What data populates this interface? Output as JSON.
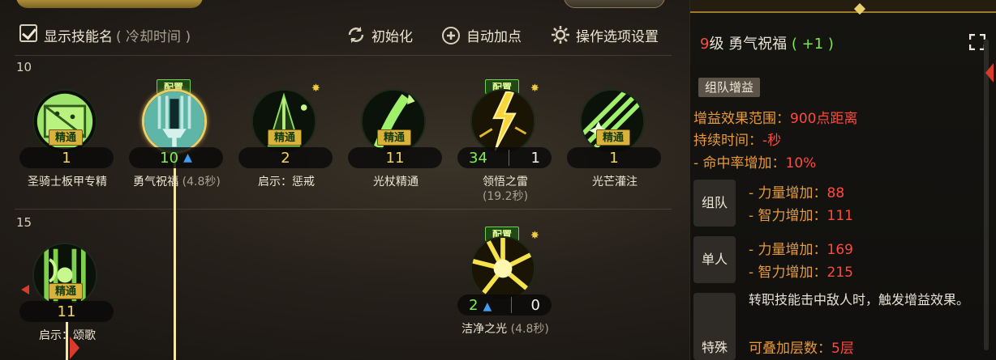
{
  "toolbar": {
    "show_names_label": "显示技能名",
    "show_names_sub": "( 冷却时间 )",
    "reset_label": "初始化",
    "auto_label": "自动加点",
    "settings_label": "操作选项设置"
  },
  "tree": {
    "level_10": "10",
    "level_15": "15",
    "skills": [
      {
        "name": "圣骑士板甲专精",
        "cd": "",
        "level": "1",
        "tag": "精通",
        "config": "",
        "bonus": "",
        "star": false,
        "selected": false
      },
      {
        "name": "勇气祝福",
        "cd": "(4.8秒)",
        "level": "10",
        "tag": "",
        "config": "配置",
        "bonus": "",
        "star": false,
        "selected": true,
        "boosted": true
      },
      {
        "name": "启示：惩戒",
        "cd": "",
        "level": "2",
        "tag": "精通",
        "config": "",
        "bonus": "",
        "star": true,
        "selected": false
      },
      {
        "name": "光杖精通",
        "cd": "",
        "level": "11",
        "tag": "精通",
        "config": "",
        "bonus": "",
        "star": false,
        "selected": false
      },
      {
        "name": "领悟之雷",
        "cd": "(19.2秒)",
        "level": "34",
        "tag": "",
        "config": "配置",
        "bonus": "1",
        "star": true,
        "selected": false
      },
      {
        "name": "光芒灌注",
        "cd": "",
        "level": "1",
        "tag": "精通",
        "config": "",
        "bonus": "",
        "star": false,
        "selected": false
      },
      {
        "name": "启示：颂歌",
        "cd": "",
        "level": "11",
        "tag": "精通",
        "config": "",
        "bonus": "",
        "star": false,
        "selected": false
      },
      {
        "name": "洁净之光",
        "cd": "(4.8秒)",
        "level": "2",
        "tag": "",
        "config": "配置",
        "bonus": "0",
        "star": true,
        "selected": false,
        "boosted": true
      }
    ]
  },
  "panel": {
    "level_num": "9",
    "level_unit": "级",
    "skill_name": "勇气祝福",
    "bonus": "( +1 )",
    "category": "组队增益",
    "range_label": "增益效果范围：",
    "range_value": "900点距离",
    "duration_label": "持续时间：",
    "duration_value": "-秒",
    "hit_label": "- 命中率增加：",
    "hit_value": "10%",
    "party_label": "组队",
    "party_str_label": "- 力量增加：",
    "party_str_value": "88",
    "party_int_label": "- 智力增加：",
    "party_int_value": "111",
    "solo_label": "单人",
    "solo_str_label": "- 力量增加：",
    "solo_str_value": "169",
    "solo_int_label": "- 智力增加：",
    "solo_int_value": "215",
    "special_label": "特殊",
    "special_text": "转职技能击中敌人时，触发增益效果。",
    "stack_label": "可叠加层数：",
    "stack_value": "5层"
  },
  "colors": {
    "accent_gold": "#e8cf6a",
    "value_red": "#ff4a3c",
    "label_orange": "#e69a3a",
    "bonus_green": "#7ee84a",
    "skill_green": "#7df04f"
  }
}
